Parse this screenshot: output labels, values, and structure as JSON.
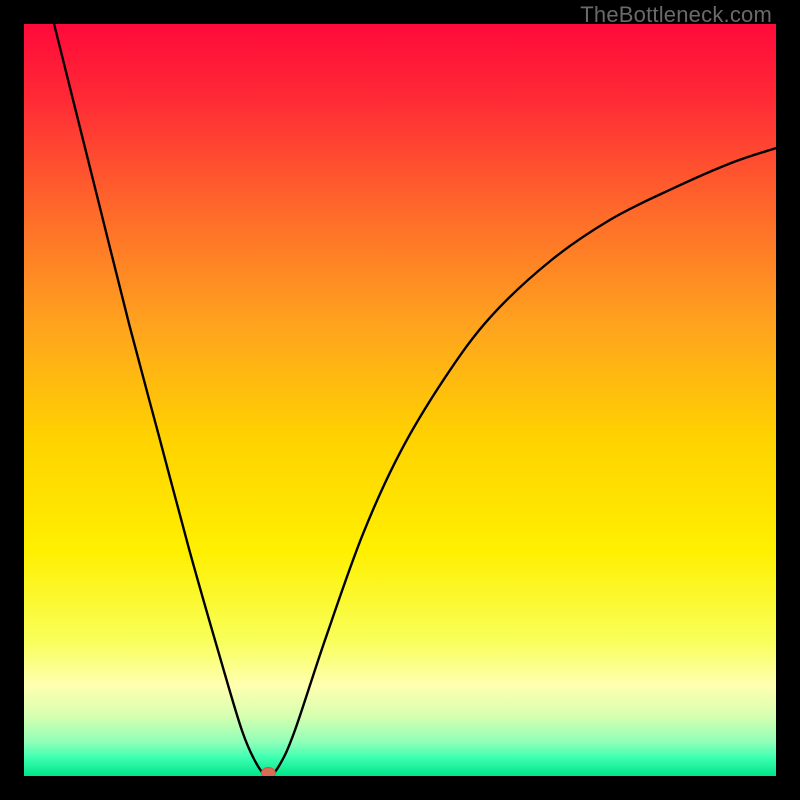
{
  "watermark": "TheBottleneck.com",
  "colors": {
    "background": "#000000",
    "gradient_stops": [
      {
        "offset": 0.0,
        "color": "#ff0a3a"
      },
      {
        "offset": 0.1,
        "color": "#ff2a36"
      },
      {
        "offset": 0.25,
        "color": "#ff6a2a"
      },
      {
        "offset": 0.4,
        "color": "#ffa31e"
      },
      {
        "offset": 0.55,
        "color": "#ffd200"
      },
      {
        "offset": 0.7,
        "color": "#fff000"
      },
      {
        "offset": 0.82,
        "color": "#f8ff5a"
      },
      {
        "offset": 0.88,
        "color": "#ffffb0"
      },
      {
        "offset": 0.92,
        "color": "#d7ffb0"
      },
      {
        "offset": 0.955,
        "color": "#8fffb8"
      },
      {
        "offset": 0.975,
        "color": "#3fffb2"
      },
      {
        "offset": 1.0,
        "color": "#00e589"
      }
    ],
    "curve": "#000000",
    "marker_fill": "#d96c56",
    "marker_stroke": "#c95a44"
  },
  "chart_data": {
    "type": "line",
    "title": "",
    "xlabel": "",
    "ylabel": "",
    "xlim": [
      0,
      100
    ],
    "ylim": [
      0,
      100
    ],
    "grid": false,
    "curve_points": [
      {
        "x": 4.0,
        "y": 100.0
      },
      {
        "x": 6.0,
        "y": 92.0
      },
      {
        "x": 10.0,
        "y": 76.0
      },
      {
        "x": 14.0,
        "y": 60.0
      },
      {
        "x": 18.0,
        "y": 45.0
      },
      {
        "x": 22.0,
        "y": 30.0
      },
      {
        "x": 26.0,
        "y": 16.0
      },
      {
        "x": 29.0,
        "y": 6.0
      },
      {
        "x": 31.0,
        "y": 1.5
      },
      {
        "x": 32.5,
        "y": 0.0
      },
      {
        "x": 34.0,
        "y": 1.5
      },
      {
        "x": 36.0,
        "y": 6.0
      },
      {
        "x": 40.0,
        "y": 18.0
      },
      {
        "x": 45.0,
        "y": 32.0
      },
      {
        "x": 50.0,
        "y": 43.0
      },
      {
        "x": 56.0,
        "y": 53.0
      },
      {
        "x": 62.0,
        "y": 61.0
      },
      {
        "x": 70.0,
        "y": 68.5
      },
      {
        "x": 78.0,
        "y": 74.0
      },
      {
        "x": 86.0,
        "y": 78.0
      },
      {
        "x": 94.0,
        "y": 81.5
      },
      {
        "x": 100.0,
        "y": 83.5
      }
    ],
    "marker": {
      "x": 32.5,
      "y": 0.0
    }
  }
}
